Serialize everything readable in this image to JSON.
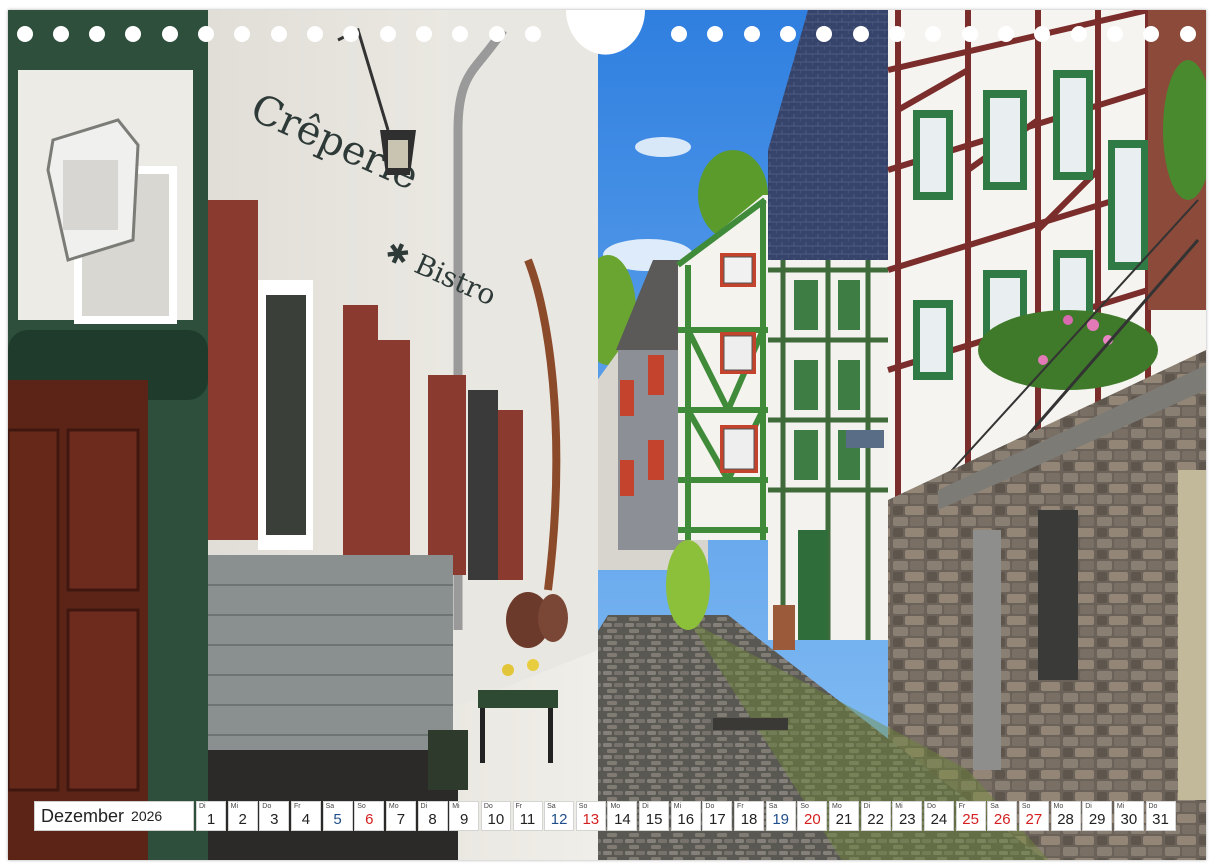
{
  "photo": {
    "subject": "cobblestone lane with half-timbered houses",
    "sign_text": [
      "Crêperie",
      "Bistro"
    ]
  },
  "calendar": {
    "month": "Dezember",
    "year": "2026",
    "colors": {
      "normal": "#222222",
      "saturday": "#1f4e8a",
      "holiday": "#d42020"
    },
    "days": [
      {
        "wd": "Di",
        "n": "1",
        "t": "normal"
      },
      {
        "wd": "Mi",
        "n": "2",
        "t": "normal"
      },
      {
        "wd": "Do",
        "n": "3",
        "t": "normal"
      },
      {
        "wd": "Fr",
        "n": "4",
        "t": "normal"
      },
      {
        "wd": "Sa",
        "n": "5",
        "t": "saturday"
      },
      {
        "wd": "So",
        "n": "6",
        "t": "holiday"
      },
      {
        "wd": "Mo",
        "n": "7",
        "t": "normal"
      },
      {
        "wd": "Di",
        "n": "8",
        "t": "normal"
      },
      {
        "wd": "Mi",
        "n": "9",
        "t": "normal"
      },
      {
        "wd": "Do",
        "n": "10",
        "t": "normal"
      },
      {
        "wd": "Fr",
        "n": "11",
        "t": "normal"
      },
      {
        "wd": "Sa",
        "n": "12",
        "t": "saturday"
      },
      {
        "wd": "So",
        "n": "13",
        "t": "holiday"
      },
      {
        "wd": "Mo",
        "n": "14",
        "t": "normal"
      },
      {
        "wd": "Di",
        "n": "15",
        "t": "normal"
      },
      {
        "wd": "Mi",
        "n": "16",
        "t": "normal"
      },
      {
        "wd": "Do",
        "n": "17",
        "t": "normal"
      },
      {
        "wd": "Fr",
        "n": "18",
        "t": "normal"
      },
      {
        "wd": "Sa",
        "n": "19",
        "t": "saturday"
      },
      {
        "wd": "So",
        "n": "20",
        "t": "holiday"
      },
      {
        "wd": "Mo",
        "n": "21",
        "t": "normal"
      },
      {
        "wd": "Di",
        "n": "22",
        "t": "normal"
      },
      {
        "wd": "Mi",
        "n": "23",
        "t": "normal"
      },
      {
        "wd": "Do",
        "n": "24",
        "t": "normal"
      },
      {
        "wd": "Fr",
        "n": "25",
        "t": "holiday"
      },
      {
        "wd": "Sa",
        "n": "26",
        "t": "holiday"
      },
      {
        "wd": "So",
        "n": "27",
        "t": "holiday"
      },
      {
        "wd": "Mo",
        "n": "28",
        "t": "normal"
      },
      {
        "wd": "Di",
        "n": "29",
        "t": "normal"
      },
      {
        "wd": "Mi",
        "n": "30",
        "t": "normal"
      },
      {
        "wd": "Do",
        "n": "31",
        "t": "normal"
      }
    ]
  }
}
